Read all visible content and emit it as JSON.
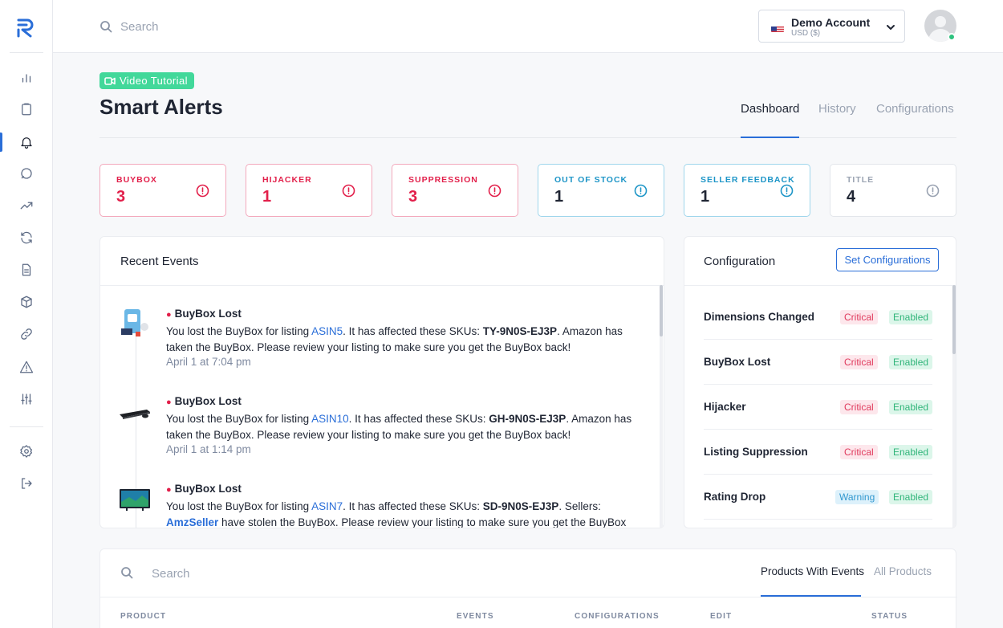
{
  "search": {
    "placeholder": "Search"
  },
  "account": {
    "name": "Demo Account",
    "currency": "USD ($)"
  },
  "header": {
    "video_label": "Video Tutorial",
    "title": "Smart Alerts"
  },
  "tabs": [
    {
      "label": "Dashboard",
      "active": true
    },
    {
      "label": "History",
      "active": false
    },
    {
      "label": "Configurations",
      "active": false
    }
  ],
  "stats": [
    {
      "label": "BUYBOX",
      "value": "3",
      "level": "critical"
    },
    {
      "label": "HIJACKER",
      "value": "1",
      "level": "critical"
    },
    {
      "label": "SUPPRESSION",
      "value": "3",
      "level": "critical"
    },
    {
      "label": "OUT OF STOCK",
      "value": "1",
      "level": "warning"
    },
    {
      "label": "SELLER FEEDBACK",
      "value": "1",
      "level": "warning"
    },
    {
      "label": "TITLE",
      "value": "4",
      "level": "info"
    }
  ],
  "recent_events": {
    "title": "Recent Events",
    "events": [
      {
        "title": "BuyBox Lost",
        "text_before": "You lost the BuyBox for listing ",
        "asin": "ASIN5",
        "text_mid": ". It has affected these SKUs: ",
        "sku": "TY-9N0S-EJ3P",
        "text_after": ". Amazon has taken the BuyBox. Please review your listing to make sure you get the BuyBox back!",
        "time": "April 1 at 7:04 pm"
      },
      {
        "title": "BuyBox Lost",
        "text_before": "You lost the BuyBox for listing ",
        "asin": "ASIN10",
        "text_mid": ". It has affected these SKUs: ",
        "sku": "GH-9N0S-EJ3P",
        "text_after": ". Amazon has taken the BuyBox. Please review your listing to make sure you get the BuyBox back!",
        "time": "April 1 at 1:14 pm"
      },
      {
        "title": "BuyBox Lost",
        "text_before": "You lost the BuyBox for listing ",
        "asin": "ASIN7",
        "text_mid": ". It has affected these SKUs: ",
        "sku": "SD-9N0S-EJ3P",
        "text_after": ". Sellers: ",
        "seller": "AmzSeller",
        "text_end": " have stolen the BuyBox. Please review your listing to make sure you get the BuyBox back!"
      }
    ]
  },
  "configuration": {
    "title": "Configuration",
    "button": "Set Configurations",
    "rows": [
      {
        "name": "Dimensions Changed",
        "severity": "Critical",
        "status": "Enabled"
      },
      {
        "name": "BuyBox Lost",
        "severity": "Critical",
        "status": "Enabled"
      },
      {
        "name": "Hijacker",
        "severity": "Critical",
        "status": "Enabled"
      },
      {
        "name": "Listing Suppression",
        "severity": "Critical",
        "status": "Enabled"
      },
      {
        "name": "Rating Drop",
        "severity": "Warning",
        "status": "Enabled"
      }
    ]
  },
  "products": {
    "search_placeholder": "Search",
    "tabs": [
      {
        "label": "Products With Events",
        "active": true
      },
      {
        "label": "All Products",
        "active": false
      }
    ],
    "columns": [
      "PRODUCT",
      "EVENTS",
      "CONFIGURATIONS",
      "EDIT",
      "STATUS"
    ]
  },
  "colors": {
    "accent": "#2a6ed8",
    "critical": "#e21f4a",
    "warning": "#1d95c7",
    "success": "#42d89a"
  }
}
